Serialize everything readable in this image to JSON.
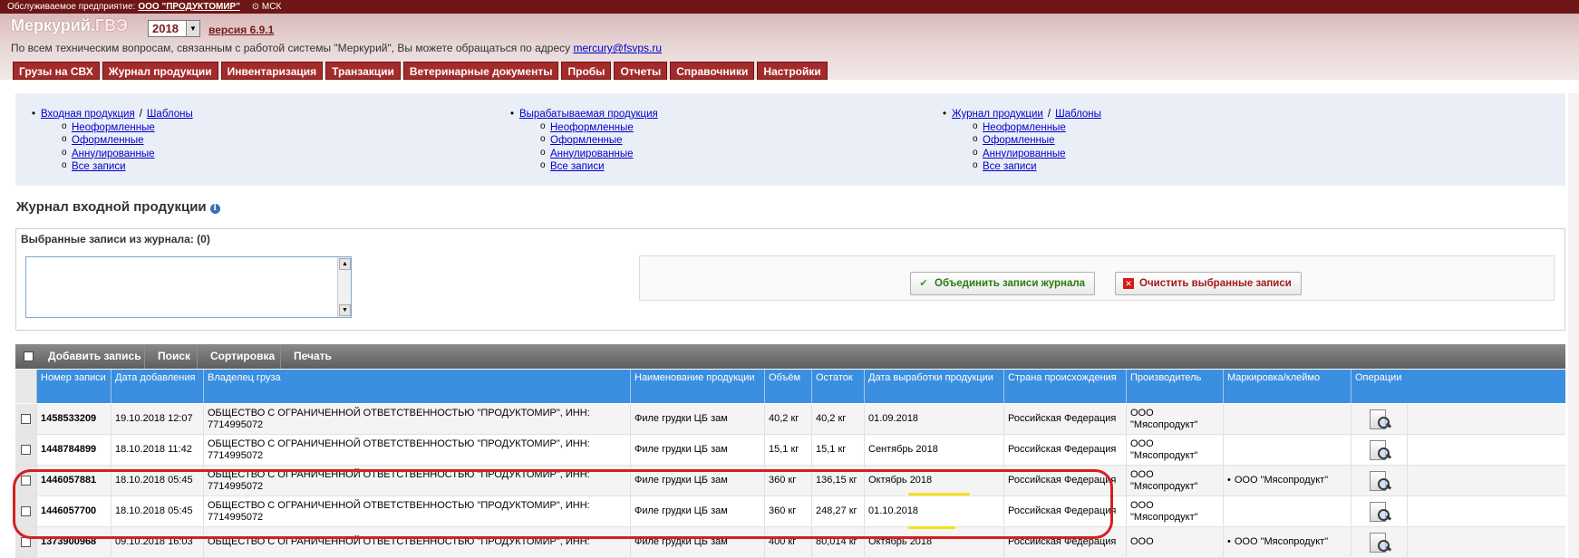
{
  "header": {
    "org_label": "Обслуживаемое предприятие:",
    "org_name": "ООО \"ПРОДУКТОМИР\"",
    "timezone": "⊙ МСК",
    "app_title": "Меркурий.",
    "app_title_suffix": "ГВЭ",
    "year": "2018",
    "version": "версия 6.9.1",
    "support_text": "По всем техническим вопросам, связанным с работой системы \"Меркурий\", Вы можете обращаться по адресу",
    "support_email": "mercury@fsvps.ru"
  },
  "nav": [
    "Грузы на СВХ",
    "Журнал продукции",
    "Инвентаризация",
    "Транзакции",
    "Ветеринарные документы",
    "Пробы",
    "Отчеты",
    "Справочники",
    "Настройки"
  ],
  "quick_links": {
    "col1": {
      "main": "Входная продукция",
      "main_extra": "Шаблоны",
      "subs": [
        "Неоформленные",
        "Оформленные",
        "Аннулированные",
        "Все записи"
      ]
    },
    "col2": {
      "main": "Вырабатываемая продукция",
      "subs": [
        "Неоформленные",
        "Оформленные",
        "Аннулированные",
        "Все записи"
      ]
    },
    "col3": {
      "main": "Журнал продукции",
      "main_extra": "Шаблоны",
      "subs": [
        "Неоформленные",
        "Оформленные",
        "Аннулированные",
        "Все записи"
      ]
    }
  },
  "page": {
    "title": "Журнал входной продукции",
    "selected_title": "Выбранные записи из журнала: (0)",
    "merge_button": "Объединить записи журнала",
    "clear_button": "Очистить выбранные записи"
  },
  "toolbar": [
    "Добавить запись",
    "Поиск",
    "Сортировка",
    "Печать"
  ],
  "columns": [
    "Номер записи",
    "Дата добавления",
    "Владелец груза",
    "Наименование продукции",
    "Объём",
    "Остаток",
    "Дата выработки продукции",
    "Страна происхождения",
    "Производитель",
    "Маркировка/клеймо",
    "Операции"
  ],
  "rows": [
    {
      "num": "1458533209",
      "date": "19.10.2018 12:07",
      "owner": "ОБЩЕСТВО С ОГРАНИЧЕННОЙ ОТВЕТСТВЕННОСТЬЮ \"ПРОДУКТОМИР\", ИНН: 7714995072",
      "product": "Филе грудки ЦБ зам",
      "volume": "40,2 кг",
      "rest": "40,2 кг",
      "prod_date": "01.09.2018",
      "country": "Российская Федерация",
      "maker": "ООО \"Мясопродукт\"",
      "marking": ""
    },
    {
      "num": "1448784899",
      "date": "18.10.2018 11:42",
      "owner": "ОБЩЕСТВО С ОГРАНИЧЕННОЙ ОТВЕТСТВЕННОСТЬЮ \"ПРОДУКТОМИР\", ИНН: 7714995072",
      "product": "Филе грудки ЦБ зам",
      "volume": "15,1 кг",
      "rest": "15,1 кг",
      "prod_date": "Сентябрь 2018",
      "country": "Российская Федерация",
      "maker": "ООО \"Мясопродукт\"",
      "marking": ""
    },
    {
      "num": "1446057881",
      "date": "18.10.2018 05:45",
      "owner": "ОБЩЕСТВО С ОГРАНИЧЕННОЙ ОТВЕТСТВЕННОСТЬЮ \"ПРОДУКТОМИР\", ИНН: 7714995072",
      "product": "Филе грудки ЦБ зам",
      "volume": "360 кг",
      "rest": "136,15 кг",
      "prod_date": "Октябрь 2018",
      "country": "Российская Федерация",
      "maker": "ООО \"Мясопродукт\"",
      "marking": "ООО \"Мясопродукт\""
    },
    {
      "num": "1446057700",
      "date": "18.10.2018 05:45",
      "owner": "ОБЩЕСТВО С ОГРАНИЧЕННОЙ ОТВЕТСТВЕННОСТЬЮ \"ПРОДУКТОМИР\", ИНН: 7714995072",
      "product": "Филе грудки ЦБ зам",
      "volume": "360 кг",
      "rest": "248,27 кг",
      "prod_date": "01.10.2018",
      "country": "Российская Федерация",
      "maker": "ООО \"Мясопродукт\"",
      "marking": ""
    },
    {
      "num": "1373900968",
      "date": "09.10.2018 16:03",
      "owner": "ОБЩЕСТВО С ОГРАНИЧЕННОЙ ОТВЕТСТВЕННОСТЬЮ \"ПРОДУКТОМИР\", ИНН:",
      "product": "Филе грудки ЦБ зам",
      "volume": "400 кг",
      "rest": "80,014 кг",
      "prod_date": "Октябрь 2018",
      "country": "Российская Федерация",
      "maker": "ООО",
      "marking": "ООО \"Мясопродукт\""
    }
  ]
}
